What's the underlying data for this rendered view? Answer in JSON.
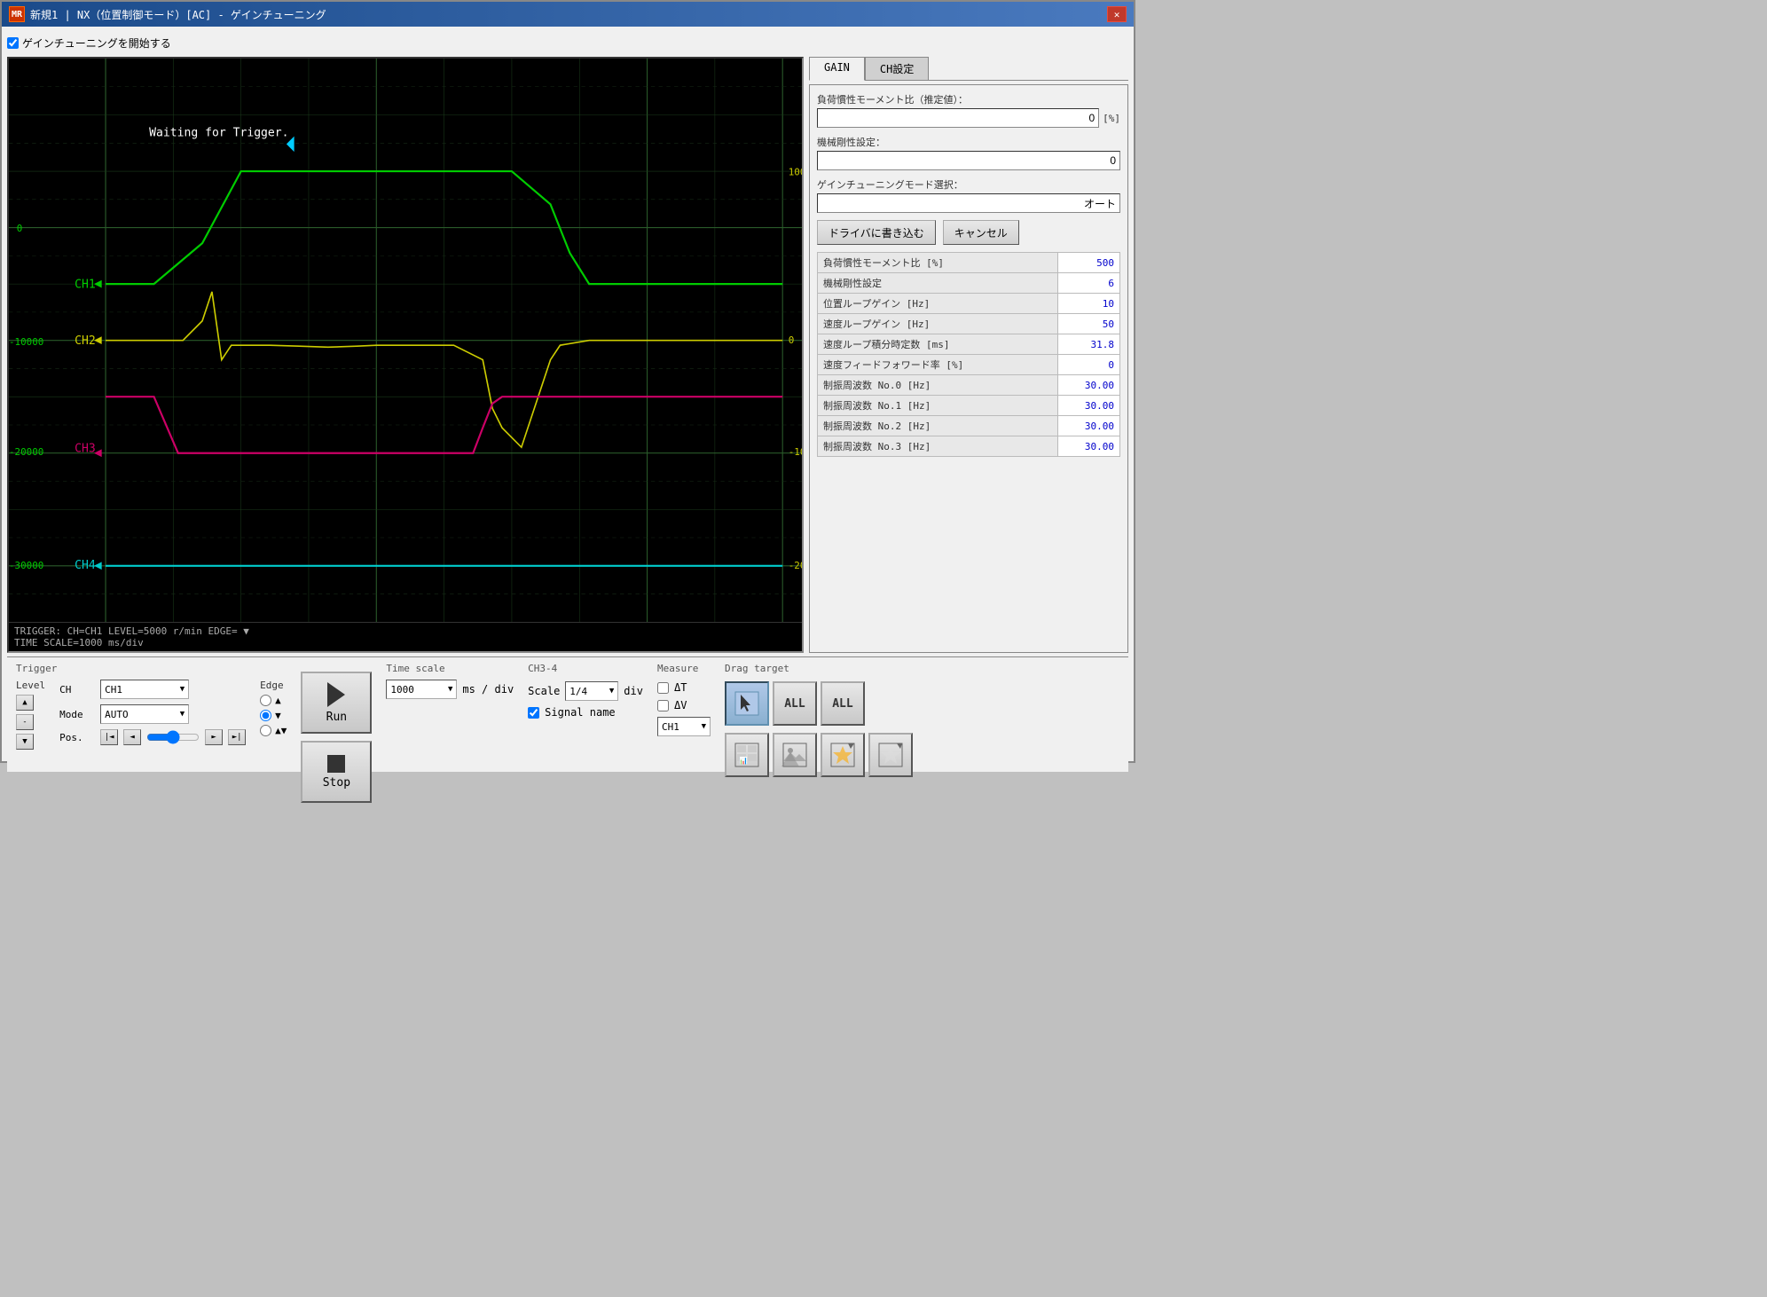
{
  "window": {
    "title": "新規1 | NX（位置制御モード）[AC] - ゲインチューニング",
    "icon": "MR",
    "close_btn": "✕"
  },
  "top_bar": {
    "checkbox_label": "ゲインチューニングを開始する",
    "checked": true
  },
  "tabs": {
    "gain_label": "GAIN",
    "ch_label": "CH設定",
    "active": "gain"
  },
  "gain_panel": {
    "inertia_label": "負荷慣性モーメント比（推定値）：",
    "inertia_value": "0",
    "inertia_unit": "[%]",
    "rigidity_label": "機械剛性設定：",
    "rigidity_value": "0",
    "tuning_mode_label": "ゲインチューニングモード選択：",
    "tuning_mode_value": "オート",
    "write_btn": "ドライバに書き込む",
    "cancel_btn": "キャンセル"
  },
  "table": {
    "rows": [
      {
        "label": "負荷慣性モーメント比 [%]",
        "value": "500"
      },
      {
        "label": "機械剛性設定",
        "value": "6"
      },
      {
        "label": "位置ループゲイン [Hz]",
        "value": "10"
      },
      {
        "label": "速度ループゲイン [Hz]",
        "value": "50"
      },
      {
        "label": "速度ループ積分時定数 [ms]",
        "value": "31.8"
      },
      {
        "label": "速度フィードフォワード率 [%]",
        "value": "0"
      },
      {
        "label": "制振周波数 No.0 [Hz]",
        "value": "30.00"
      },
      {
        "label": "制振周波数 No.1 [Hz]",
        "value": "30.00"
      },
      {
        "label": "制振周波数 No.2 [Hz]",
        "value": "30.00"
      },
      {
        "label": "制振周波数 No.3 [Hz]",
        "value": "30.00"
      }
    ]
  },
  "scope": {
    "status_text": "Waiting for Trigger.",
    "trigger_info": "TRIGGER: CH=CH1 LEVEL=5000 r/min EDGE= ▼",
    "time_scale_info": "TIME SCALE=1000 ms/div"
  },
  "bottom": {
    "trigger_section_label": "Trigger",
    "level_label": "Level",
    "ch_label": "CH",
    "ch_value": "CH1",
    "mode_label": "Mode",
    "mode_value": "AUTO",
    "edge_label": "Edge",
    "pos_label": "Pos.",
    "run_btn": "Run",
    "stop_btn": "Stop",
    "time_scale_label": "Time scale",
    "time_scale_value": "1000",
    "time_unit": "ms / div",
    "ch34_label": "CH3-4",
    "scale_label": "Scale",
    "scale_value": "1/4",
    "div_label": "div",
    "signal_name_label": "Signal name",
    "measure_label": "Measure",
    "delta_t_label": "ΔT",
    "delta_v_label": "ΔV",
    "measure_ch_value": "CH1",
    "drag_label": "Drag target",
    "all_label1": "ALL",
    "all_label2": "ALL"
  }
}
